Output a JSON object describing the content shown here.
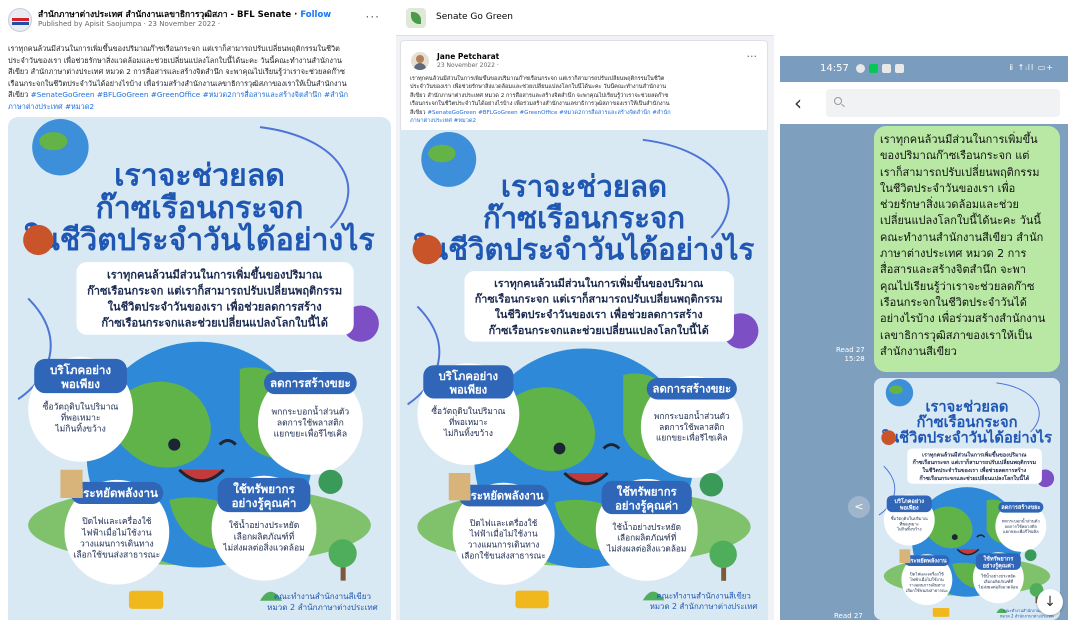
{
  "colors": {
    "poster_bg": "#d9e9f4",
    "title_blue": "#1f57b3",
    "circle_blue": "#2f66b8",
    "fb_link": "#216fdb",
    "chat_bg": "#7f9fbf",
    "bubble_green": "#b8e8a4"
  },
  "fb_post": {
    "page_name": "สำนักภาษาต่างประเทศ สำนักงานเลขาธิการวุฒิสภา - BFL Senate",
    "follow": "Follow",
    "separator": "·",
    "meta": "Published by Apisit Saojumpa · 23 November 2022 ·",
    "more": "···",
    "text_lines": [
      "เราทุกคนล้วนมีส่วนในการเพิ่มขึ้นของปริมาณก๊าซเรือนกระจก แต่เราก็สามารถปรับเปลี่ยนพฤติกรรมในชีวิต",
      "ประจำวันของเรา เพื่อช่วยรักษาสิ่งแวดล้อมและช่วยเปลี่ยนแปลงโลกใบนี้ได้นะคะ วันนี้คณะทำงานสำนักงาน",
      "สีเขียว สำนักภาษาต่างประเทศ หมวด 2 การสื่อสารและสร้างจิตสำนึก จะพาคุณไปเรียนรู้ว่าเราจะช่วยลดก๊าซ",
      "เรือนกระจกในชีวิตประจำวันได้อย่างไรบ้าง เพื่อร่วมสร้างสำนักงานเลขาธิการวุฒิสภาของเราให้เป็นสำนักงาน"
    ],
    "text_line5_prefix": "สีเขียว",
    "hashtags_line5": "#SenateGoGreen #BFLGoGreen #GreenOffice #หมวด2การสื่อสารและสร้างจิตสำนึก #สำนัก",
    "hashtags_line6": "ภาษาต่างประเทศ #หมวด2"
  },
  "group": {
    "name": "Senate Go Green",
    "author": "Jane Petcharat",
    "date": "23 November 2022 · ",
    "more": "···",
    "text_lines": [
      "เราทุกคนล้วนมีส่วนในการเพิ่มขึ้นของปริมาณก๊าซเรือนกระจก แต่เราก็สามารถปรับเปลี่ยนพฤติกรรมในชีวิต",
      "ประจำวันของเรา เพื่อช่วยรักษาสิ่งแวดล้อมและช่วยเปลี่ยนแปลงโลกใบนี้ได้นะคะ วันนี้คณะทำงานสำนักงาน",
      "สีเขียว สำนักภาษาต่างประเทศ หมวด 2 การสื่อสารและสร้างจิตสำนึก จะพาคุณไปเรียนรู้ว่าเราจะช่วยลดก๊าซ",
      "เรือนกระจกในชีวิตประจำวันได้อย่างไรบ้าง เพื่อร่วมสร้างสำนักงานเลขาธิการวุฒิสภาของเราให้เป็นสำนักงาน"
    ],
    "text_line5_prefix": "สีเขียว",
    "hashtags_line5": "#SenateGoGreen #BFLGoGreen #GreenOffice #หมวด2การสื่อสารและสร้างจิตสำนึก #สำนัก",
    "hashtags_line6": "ภาษาต่างประเทศ #หมวด2"
  },
  "poster": {
    "title_line1": "เราจะช่วยลด",
    "title_line2": "ก๊าซเรือนกระจก",
    "title_line3": "ในชีวิตประจำวันได้อย่างไร",
    "intro_lines": [
      "เราทุกคนล้วนมีส่วนในการเพิ่มขึ้นของปริมาณ",
      "ก๊าซเรือนกระจก แต่เราก็สามารถปรับเปลี่ยนพฤติกรรม",
      "ในชีวิตประจำวันของเรา เพื่อช่วยลดการสร้าง",
      "ก๊าซเรือนกระจกและช่วยเปลี่ยนแปลงโลกใบนี้ได้"
    ],
    "tips": [
      {
        "title_lines": [
          "บริโภคอย่าง",
          "พอเพียง"
        ],
        "desc_lines": [
          "ซื้อวัตถุดิบในปริมาณ",
          "ที่พอเหมาะ",
          "ไม่กินทิ้งขว้าง"
        ]
      },
      {
        "title_lines": [
          "ลดการสร้างขยะ"
        ],
        "desc_lines": [
          "พกกระบอกน้ำส่วนตัว",
          "ลดการใช้พลาสติก",
          "แยกขยะเพื่อรีไซเคิล"
        ]
      },
      {
        "title_lines": [
          "ประหยัดพลังงาน"
        ],
        "desc_lines": [
          "ปิดไฟและเครื่องใช้",
          "ไฟฟ้าเมื่อไม่ใช้งาน",
          "วางแผนการเดินทาง",
          "เลือกใช้ขนส่งสาธารณะ"
        ]
      },
      {
        "title_lines": [
          "ใช้ทรัพยากร",
          "อย่างรู้คุณค่า"
        ],
        "desc_lines": [
          "ใช้น้ำอย่างประหยัด",
          "เลือกผลิตภัณฑ์ที่",
          "ไม่ส่งผลต่อสิ่งแวดล้อม"
        ]
      }
    ],
    "credit_lines": [
      "คณะทำงานสำนักงานสีเขียว",
      "หมวด 2 สำนักภาษาต่างประเทศ"
    ]
  },
  "chat": {
    "time": "14:57",
    "status_right": "ⅱ ↑ᵢll ▭+",
    "back": "‹",
    "bubble_lines": [
      "เราทุกคนล้วนมีส่วนในการเพิ่มขึ้น",
      "ของปริมาณก๊าซเรือนกระจก แต่",
      "เราก็สามารถปรับเปลี่ยนพฤติกรรม",
      "ในชีวิตประจำวันของเรา เพื่อ",
      "ช่วยรักษาสิ่งแวดล้อมและช่วย",
      "เปลี่ยนแปลงโลกใบนี้ได้นะคะ วันนี้",
      "คณะทำงานสำนักงานสีเขียว สำนัก",
      "ภาษาต่างประเทศ หมวด 2 การ",
      "สื่อสารและสร้างจิตสำนึก จะพา",
      "คุณไปเรียนรู้ว่าเราจะช่วยลดก๊าซ",
      "เรือนกระจกในชีวิตประจำวันได้",
      "อย่างไรบ้าง เพื่อร่วมสร้างสำนักงาน",
      "เลขาธิการวุฒิสภาของเราให้เป็น",
      "สำนักงานสีเขียว"
    ],
    "read1_label": "Read 27",
    "read1_time": "15:28",
    "read2_label": "Read 27",
    "down": "↓",
    "share": "<"
  }
}
